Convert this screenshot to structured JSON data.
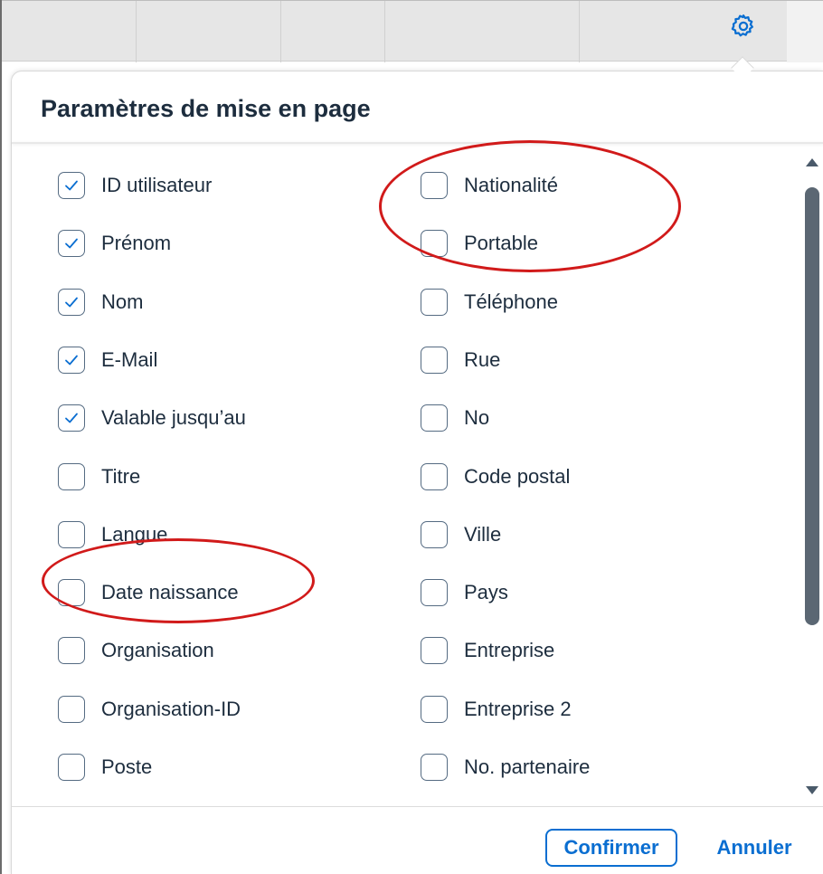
{
  "dialog": {
    "title": "Paramètres de mise en page",
    "confirm_label": "Confirmer",
    "cancel_label": "Annuler"
  },
  "toolbar": {
    "settings_icon": "gear-icon"
  },
  "fields": {
    "left": [
      {
        "label": "ID utilisateur",
        "checked": true
      },
      {
        "label": "Prénom",
        "checked": true
      },
      {
        "label": "Nom",
        "checked": true
      },
      {
        "label": "E-Mail",
        "checked": true
      },
      {
        "label": "Valable jusqu’au",
        "checked": true
      },
      {
        "label": "Titre",
        "checked": false
      },
      {
        "label": "Langue",
        "checked": false
      },
      {
        "label": "Date naissance",
        "checked": false
      },
      {
        "label": "Organisation",
        "checked": false
      },
      {
        "label": "Organisation-ID",
        "checked": false
      },
      {
        "label": "Poste",
        "checked": false
      }
    ],
    "right": [
      {
        "label": "Nationalité",
        "checked": false
      },
      {
        "label": "Portable",
        "checked": false
      },
      {
        "label": "Téléphone",
        "checked": false
      },
      {
        "label": "Rue",
        "checked": false
      },
      {
        "label": "No",
        "checked": false
      },
      {
        "label": "Code postal",
        "checked": false
      },
      {
        "label": "Ville",
        "checked": false
      },
      {
        "label": "Pays",
        "checked": false
      },
      {
        "label": "Entreprise",
        "checked": false
      },
      {
        "label": "Entreprise 2",
        "checked": false
      },
      {
        "label": "No. partenaire",
        "checked": false
      }
    ]
  },
  "colors": {
    "accent": "#0a6ed1",
    "annotation": "#d11a1a",
    "text": "#1d2d3e"
  }
}
